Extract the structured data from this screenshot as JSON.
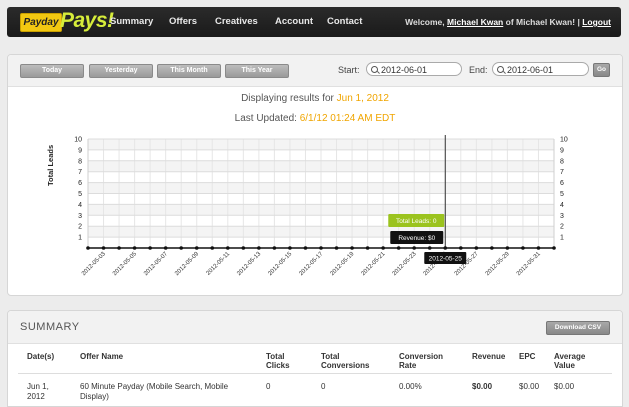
{
  "nav": {
    "logo_box": "Payday",
    "logo_text": "Pays!",
    "items": [
      "Summary",
      "Offers",
      "Creatives",
      "Account",
      "Contact"
    ],
    "welcome_prefix": "Welcome,",
    "user": "Michael Kwan",
    "welcome_mid": "of Michael Kwan!",
    "separator": "|",
    "logout": "Logout"
  },
  "filters": {
    "today": "Today",
    "yesterday": "Yesterday",
    "this_month": "This Month",
    "this_year": "This Year",
    "start_label": "Start:",
    "start_value": "2012-06-01",
    "end_label": "End:",
    "end_value": "2012-06-01",
    "go": "Go"
  },
  "info": {
    "displaying_prefix": "Displaying results for",
    "displaying_date": "Jun 1, 2012",
    "updated_prefix": "Last Updated:",
    "updated_value": "6/1/12 01:24 AM EDT"
  },
  "chart_data": {
    "type": "line",
    "ylabel": "Total Leads",
    "ylim": [
      0,
      10
    ],
    "yticks": [
      1,
      2,
      3,
      4,
      5,
      6,
      7,
      8,
      9,
      10
    ],
    "x": [
      "2012-05-02",
      "2012-05-03",
      "2012-05-04",
      "2012-05-05",
      "2012-05-06",
      "2012-05-07",
      "2012-05-08",
      "2012-05-09",
      "2012-05-10",
      "2012-05-11",
      "2012-05-12",
      "2012-05-13",
      "2012-05-14",
      "2012-05-15",
      "2012-05-16",
      "2012-05-17",
      "2012-05-18",
      "2012-05-19",
      "2012-05-20",
      "2012-05-21",
      "2012-05-22",
      "2012-05-23",
      "2012-05-24",
      "2012-05-25",
      "2012-05-26",
      "2012-05-27",
      "2012-05-28",
      "2012-05-29",
      "2012-05-30",
      "2012-05-31",
      "2012-06-01"
    ],
    "xtick_labels": [
      "2012-05-03",
      "2012-05-05",
      "2012-05-07",
      "2012-05-09",
      "2012-05-11",
      "2012-05-13",
      "2012-05-15",
      "2012-05-17",
      "2012-05-19",
      "2012-05-21",
      "2012-05-23",
      "2012-05-25",
      "2012-05-27",
      "2012-05-29",
      "2012-05-31"
    ],
    "series": [
      {
        "values": [
          0,
          0,
          0,
          0,
          0,
          0,
          0,
          0,
          0,
          0,
          0,
          0,
          0,
          0,
          0,
          0,
          0,
          0,
          0,
          0,
          0,
          0,
          0,
          0,
          0,
          0,
          0,
          0,
          0,
          0,
          0
        ],
        "color": "#111111"
      }
    ],
    "grid": true,
    "hover": {
      "date": "2012-05-25",
      "leads_label": "Total Leads: 0",
      "revenue_label": "Revenue: $0",
      "leads_color": "#9bc31e"
    }
  },
  "summary": {
    "title": "SUMMARY",
    "download": "Download CSV",
    "headers": {
      "date": "Date(s)",
      "offer": "Offer Name",
      "clicks": "Total Clicks",
      "conversions": "Total Conversions",
      "rate": "Conversion Rate",
      "revenue": "Revenue",
      "epc": "EPC",
      "avg": "Average Value"
    },
    "row": {
      "date": "Jun 1, 2012",
      "offer": "60 Minute Payday (Mobile Search, Mobile Display)",
      "clicks": "0",
      "conversions": "0",
      "rate": "0.00%",
      "revenue": "$0.00",
      "epc": "$0.00",
      "avg": "$0.00"
    }
  }
}
